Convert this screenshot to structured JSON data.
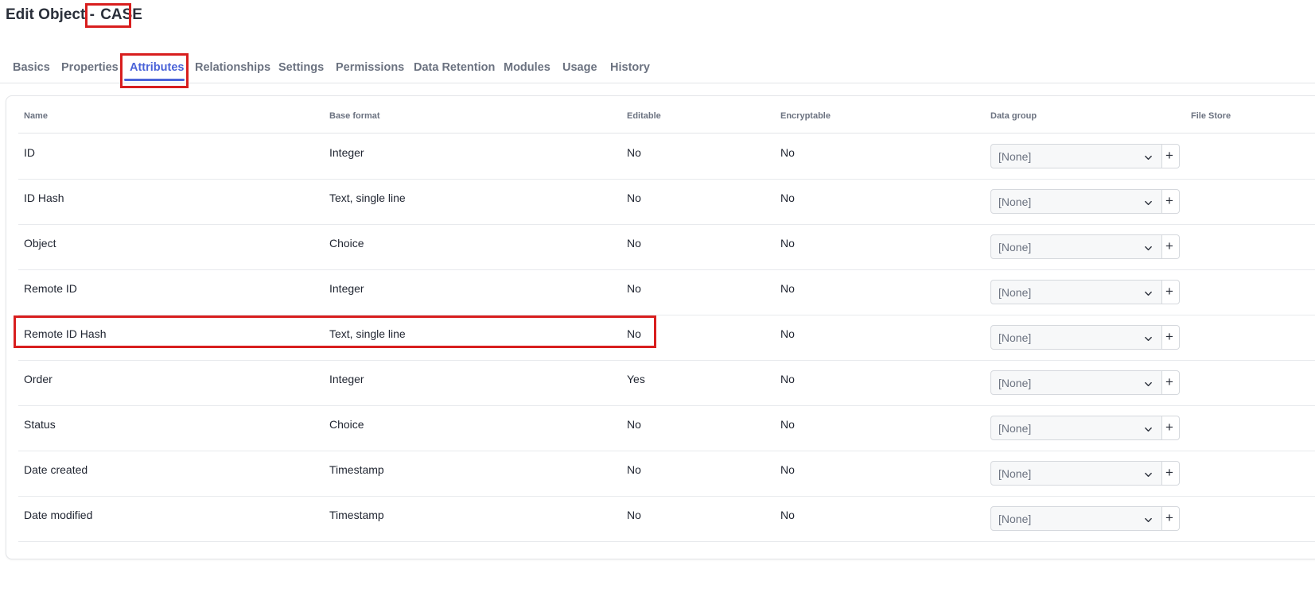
{
  "header": {
    "title_prefix": "Edit Object - ",
    "object_name": "CASE"
  },
  "tabs": [
    {
      "label": "Basics",
      "active": false
    },
    {
      "label": "Properties",
      "active": false
    },
    {
      "label": "Attributes",
      "active": true
    },
    {
      "label": "Relationships",
      "active": false
    },
    {
      "label": "Settings",
      "active": false
    },
    {
      "label": "Permissions",
      "active": false
    },
    {
      "label": "Data Retention",
      "active": false
    },
    {
      "label": "Modules",
      "active": false
    },
    {
      "label": "Usage",
      "active": false
    },
    {
      "label": "History",
      "active": false
    }
  ],
  "table": {
    "columns": [
      "Name",
      "Base format",
      "Editable",
      "Encryptable",
      "Data group",
      "File Store"
    ],
    "rows": [
      {
        "name": "ID",
        "base_format": "Integer",
        "editable": "No",
        "encryptable": "No",
        "data_group": "[None]"
      },
      {
        "name": "ID Hash",
        "base_format": "Text, single line",
        "editable": "No",
        "encryptable": "No",
        "data_group": "[None]"
      },
      {
        "name": "Object",
        "base_format": "Choice",
        "editable": "No",
        "encryptable": "No",
        "data_group": "[None]"
      },
      {
        "name": "Remote ID",
        "base_format": "Integer",
        "editable": "No",
        "encryptable": "No",
        "data_group": "[None]"
      },
      {
        "name": "Remote ID Hash",
        "base_format": "Text, single line",
        "editable": "No",
        "encryptable": "No",
        "data_group": "[None]"
      },
      {
        "name": "Order",
        "base_format": "Integer",
        "editable": "Yes",
        "encryptable": "No",
        "data_group": "[None]"
      },
      {
        "name": "Status",
        "base_format": "Choice",
        "editable": "No",
        "encryptable": "No",
        "data_group": "[None]"
      },
      {
        "name": "Date created",
        "base_format": "Timestamp",
        "editable": "No",
        "encryptable": "No",
        "data_group": "[None]"
      },
      {
        "name": "Date modified",
        "base_format": "Timestamp",
        "editable": "No",
        "encryptable": "No",
        "data_group": "[None]"
      }
    ],
    "add_button_label": "+"
  },
  "colors": {
    "accent": "#4a63d8",
    "highlight": "#d81e1e",
    "text": "#1f2430",
    "muted": "#6b7280"
  }
}
